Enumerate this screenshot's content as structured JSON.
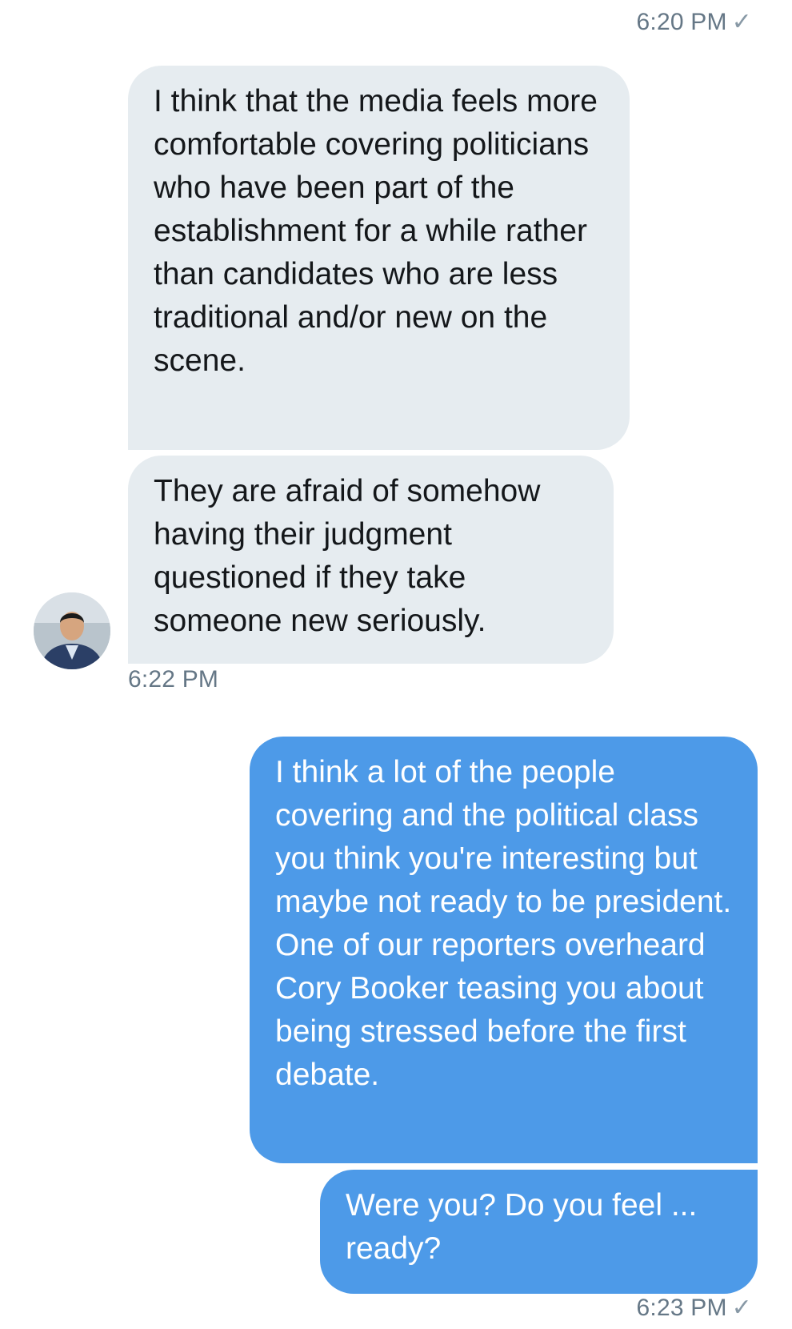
{
  "conversation": {
    "timestamps": {
      "first_sent": "6:20 PM",
      "received": "6:22 PM",
      "last_sent": "6:23 PM"
    },
    "read_mark": "✓",
    "messages": [
      {
        "direction": "incoming",
        "text": "I think that the media feels more comfortable covering politicians who have been part of the establishment for a while rather than candidates who are less traditional and/or new on the scene."
      },
      {
        "direction": "incoming",
        "text": "They are afraid of somehow having their judgment questioned if they take someone new seriously."
      },
      {
        "direction": "outgoing",
        "text": "I think a lot of the people covering and the political class you think you're interesting but maybe not ready to be president. One of our reporters overheard Cory Booker teasing you about being stressed before the first debate."
      },
      {
        "direction": "outgoing",
        "text": "Were you? Do you feel ... ready?"
      }
    ],
    "avatar_icon": "contact-avatar-photo"
  },
  "colors": {
    "incoming_bubble": "#e6ecf0",
    "outgoing_bubble": "#4d9ae8",
    "timestamp_text": "#657786"
  }
}
